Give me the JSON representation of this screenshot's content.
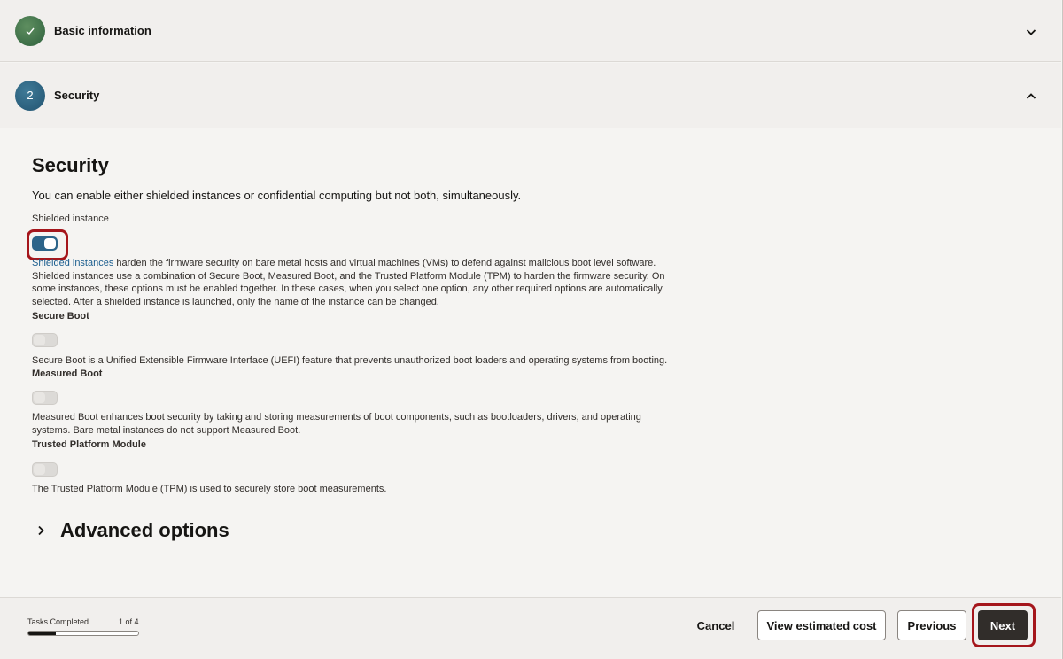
{
  "steps": [
    {
      "number": "✓",
      "title": "Basic information",
      "status": "complete"
    },
    {
      "number": "2",
      "title": "Security",
      "status": "active"
    }
  ],
  "section": {
    "title": "Security",
    "intro": "You can enable either shielded instances or confidential computing but not both, simultaneously.",
    "shielded_label": "Shielded instance",
    "shielded_on": true,
    "shielded_link": "Shielded instances",
    "shielded_desc_rest": " harden the firmware security on bare metal hosts and virtual machines (VMs) to defend against malicious boot level software. Shielded instances use a combination of Secure Boot, Measured Boot, and the Trusted Platform Module (TPM) to harden the firmware security. On some instances, these options must be enabled together. In these cases, when you select one option, any other required options are automatically selected. After a shielded instance is launched, only the name of the instance can be changed.",
    "secure_boot_label": "Secure Boot",
    "secure_boot_on": false,
    "secure_boot_desc": "Secure Boot is a Unified Extensible Firmware Interface (UEFI) feature that prevents unauthorized boot loaders and operating systems from booting.",
    "measured_boot_label": "Measured Boot",
    "measured_boot_on": false,
    "measured_boot_desc": "Measured Boot enhances boot security by taking and storing measurements of boot components, such as bootloaders, drivers, and operating systems. Bare metal instances do not support Measured Boot.",
    "tpm_label": "Trusted Platform Module",
    "tpm_on": false,
    "tpm_desc": "The Trusted Platform Module (TPM) is used to securely store boot measurements."
  },
  "advanced": {
    "label": "Advanced options"
  },
  "footer": {
    "tasks_label": "Tasks Completed",
    "tasks_count": "1 of 4",
    "progress_fraction": 0.25,
    "cancel": "Cancel",
    "view_cost": "View estimated cost",
    "previous": "Previous",
    "next": "Next"
  },
  "icons": {
    "step1": "checkmark-icon",
    "step1_chevron": "chevron-down-icon",
    "step2_chevron": "chevron-up-icon",
    "advanced": "chevron-right-icon"
  },
  "colors": {
    "accent": "#2c6489",
    "highlight": "#a5161c",
    "complete_step": "#3c6e47",
    "active_step": "#2b5f7c",
    "primary_button": "#312d2a"
  }
}
